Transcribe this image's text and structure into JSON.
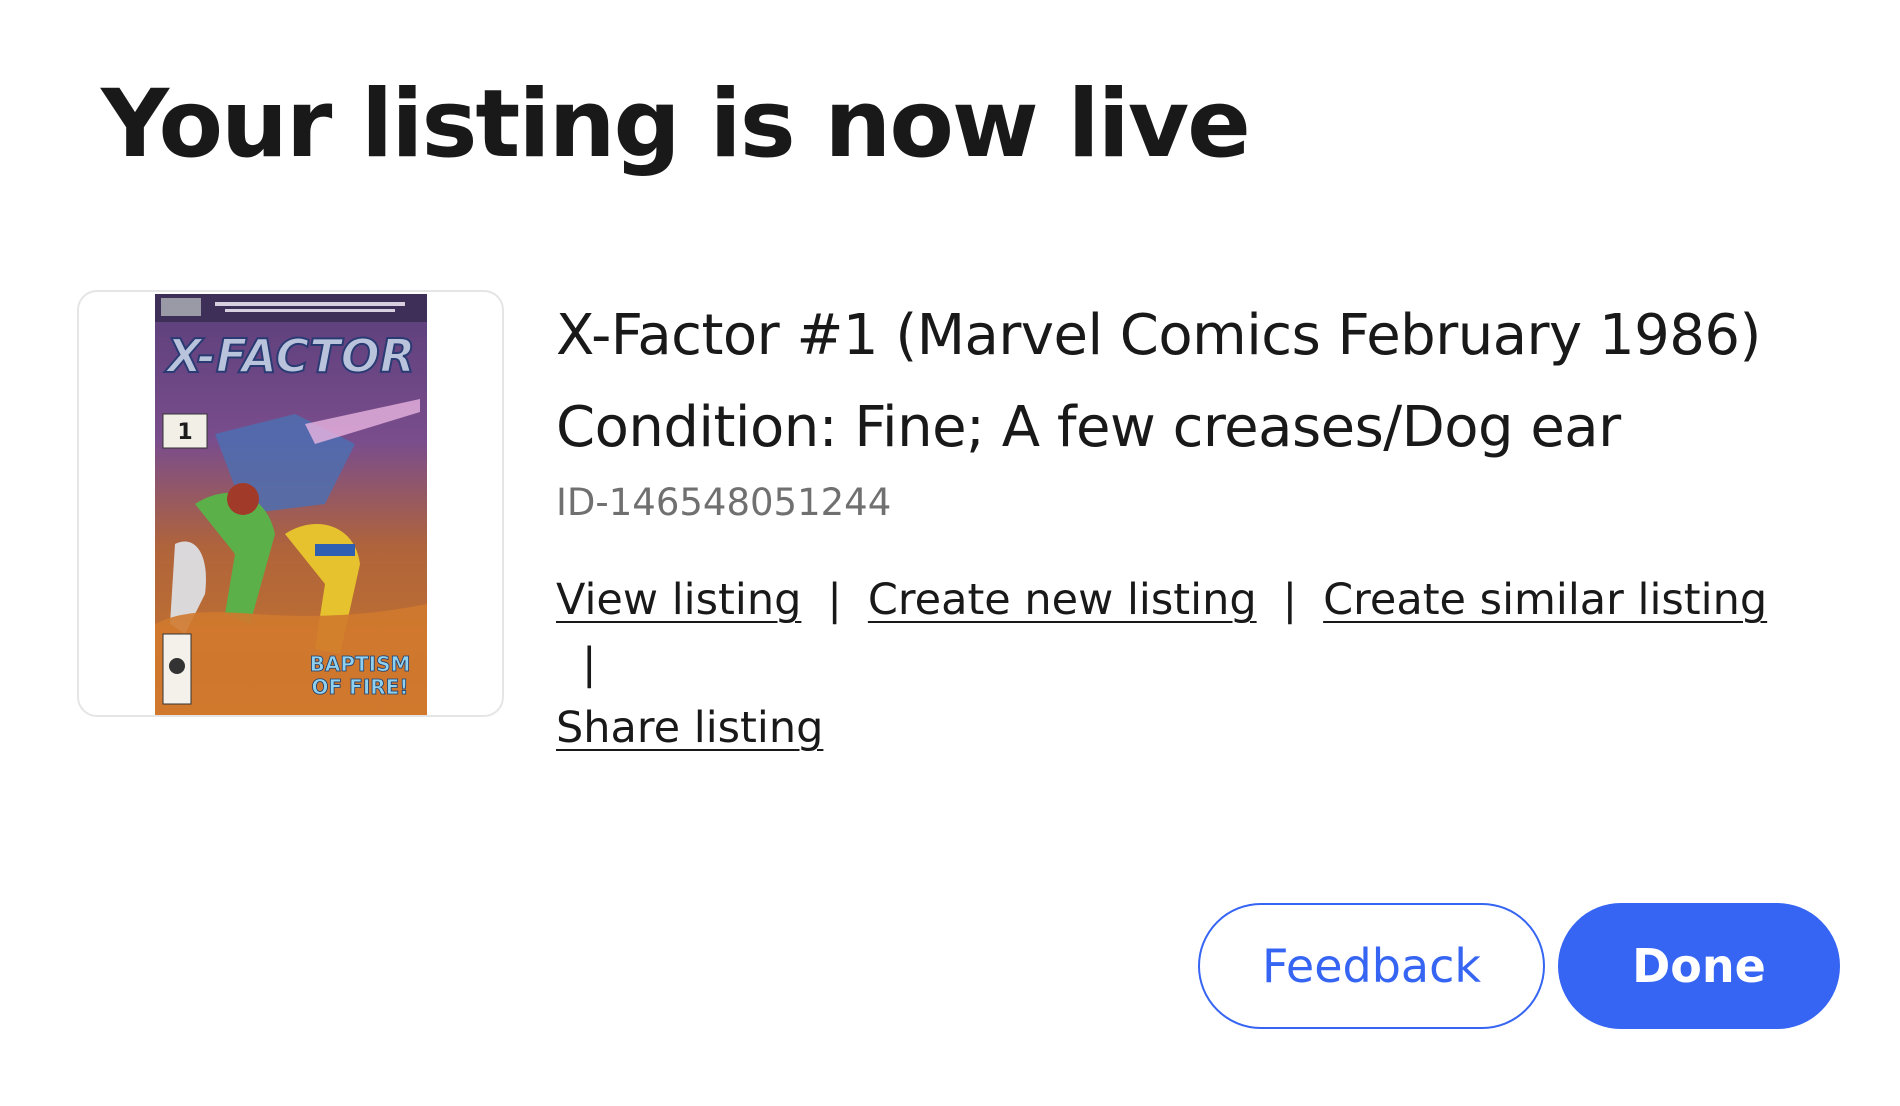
{
  "dialog": {
    "title": "Your listing is now live"
  },
  "listing": {
    "title": "X-Factor #1 (Marvel Comics February 1986) Condition: Fine; A few creases/Dog ear",
    "id": "ID-146548051244",
    "thumbnail": {
      "logo": "X-FACTOR",
      "issue": "1",
      "tagline_line1": "BAPTISM",
      "tagline_line2": "OF FIRE!"
    }
  },
  "links": {
    "view": "View listing",
    "create_new": "Create new listing",
    "create_similar": "Create similar listing",
    "share": "Share listing",
    "separator": "|"
  },
  "buttons": {
    "feedback": "Feedback",
    "done": "Done"
  },
  "colors": {
    "accent": "#3665f3",
    "text": "#191919",
    "muted": "#707070"
  }
}
